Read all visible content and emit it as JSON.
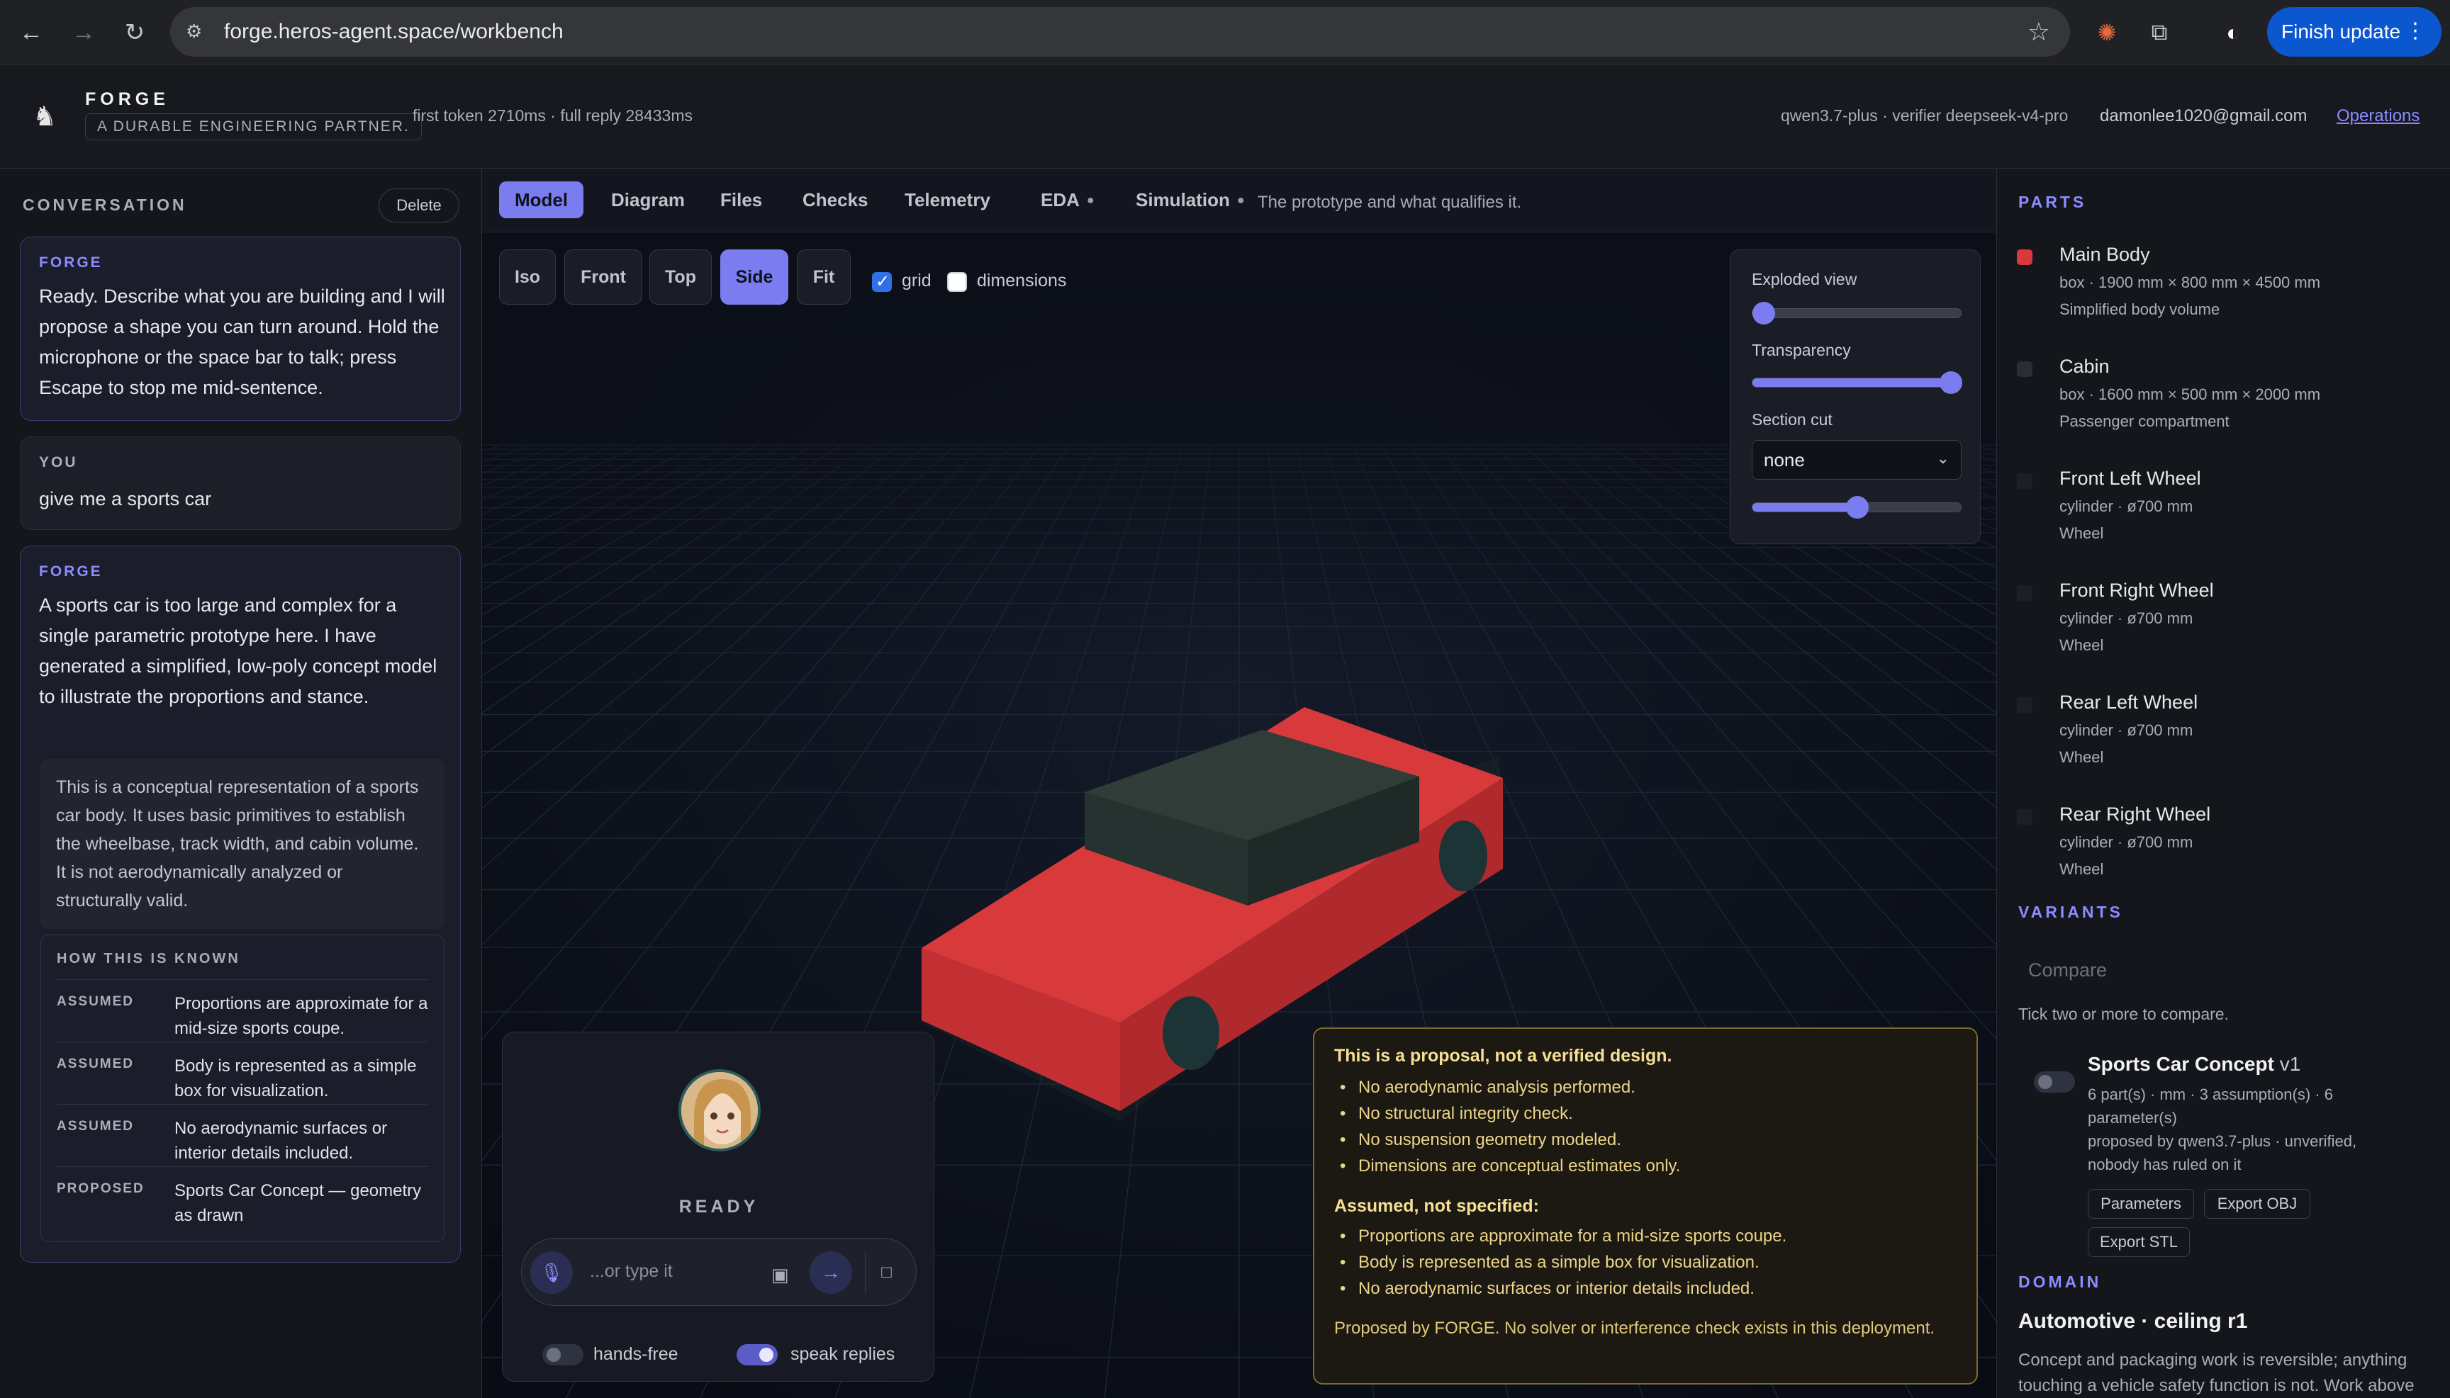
{
  "browser": {
    "url": "forge.heros-agent.space/workbench",
    "finish_update": "Finish update"
  },
  "header": {
    "brand": "FORGE",
    "tagline": "A DURABLE ENGINEERING PARTNER.",
    "timing": "first token 2710ms · full reply 28433ms",
    "model_info": "qwen3.7-plus · verifier deepseek-v4-pro",
    "user_email": "damonlee1020@gmail.com",
    "operations_link": "Operations"
  },
  "conversation": {
    "title": "CONVERSATION",
    "delete_label": "Delete",
    "messages": [
      {
        "sender": "FORGE",
        "text": "Ready. Describe what you are building and I will propose a shape you can turn around. Hold the microphone or the space bar to talk; press Escape to stop me mid-sentence."
      },
      {
        "sender": "YOU",
        "text": "give me a sports car"
      },
      {
        "sender": "FORGE",
        "text": "A sports car is too large and complex for a single parametric prototype here. I have generated a simplified, low-poly concept model to illustrate the proportions and stance.",
        "note": "This is a conceptual representation of a sports car body. It uses basic primitives to establish the wheelbase, track width, and cabin volume. It is not aerodynamically analyzed or structurally valid.",
        "known_title": "HOW THIS IS KNOWN",
        "known": [
          {
            "tag": "ASSUMED",
            "text": "Proportions are approximate for a mid-size sports coupe."
          },
          {
            "tag": "ASSUMED",
            "text": "Body is represented as a simple box for visualization."
          },
          {
            "tag": "ASSUMED",
            "text": "No aerodynamic surfaces or interior details included."
          },
          {
            "tag": "PROPOSED",
            "text": "Sports Car Concept — geometry as drawn"
          }
        ]
      }
    ]
  },
  "tabs": {
    "items": [
      "Model",
      "Diagram",
      "Files",
      "Checks",
      "Telemetry",
      "EDA",
      "Simulation"
    ],
    "dot": "●",
    "active": "Model",
    "description": "The prototype and what qualifies it."
  },
  "viewport": {
    "views": [
      "Iso",
      "Front",
      "Top",
      "Side",
      "Fit"
    ],
    "active_view": "Side",
    "grid_label": "grid",
    "grid_checked": true,
    "dimensions_label": "dimensions",
    "dimensions_checked": false,
    "controls": {
      "exploded_label": "Exploded view",
      "exploded_value": 0.0,
      "transparency_label": "Transparency",
      "transparency_value": 1.0,
      "section_label": "Section cut",
      "section_value": "none",
      "section_position": 0.5
    },
    "colors": {
      "body": "#d83a3c",
      "cabin": "#233230",
      "accent": "#7b7cf0"
    }
  },
  "voice": {
    "status": "READY",
    "input_placeholder": "...or type it",
    "hands_free_label": "hands-free",
    "hands_free_on": false,
    "speak_replies_label": "speak replies",
    "speak_replies_on": true
  },
  "proposal": {
    "title": "This is a proposal, not a verified design.",
    "items": [
      "No aerodynamic analysis performed.",
      "No structural integrity check.",
      "No suspension geometry modeled.",
      "Dimensions are conceptual estimates only."
    ],
    "assumed_title": "Assumed, not specified:",
    "assumed": [
      "Proportions are approximate for a mid-size sports coupe.",
      "Body is represented as a simple box for visualization.",
      "No aerodynamic surfaces or interior details included."
    ],
    "footer": "Proposed by FORGE. No solver or interference check exists in this deployment."
  },
  "parts": {
    "title": "PARTS",
    "items": [
      {
        "name": "Main Body",
        "dims": "box · 1900 mm × 800 mm × 4500 mm",
        "desc": "Simplified body volume",
        "color": "#d83a3c"
      },
      {
        "name": "Cabin",
        "dims": "box · 1600 mm × 500 mm × 2000 mm",
        "desc": "Passenger compartment",
        "color": "#2a2d36"
      },
      {
        "name": "Front Left Wheel",
        "dims": "cylinder · ø700 mm",
        "desc": "Wheel",
        "color": "#1c1f27"
      },
      {
        "name": "Front Right Wheel",
        "dims": "cylinder · ø700 mm",
        "desc": "Wheel",
        "color": "#1c1f27"
      },
      {
        "name": "Rear Left Wheel",
        "dims": "cylinder · ø700 mm",
        "desc": "Wheel",
        "color": "#1c1f27"
      },
      {
        "name": "Rear Right Wheel",
        "dims": "cylinder · ø700 mm",
        "desc": "Wheel",
        "color": "#1c1f27"
      }
    ]
  },
  "variants": {
    "title": "VARIANTS",
    "compare_placeholder": "Compare",
    "hint": "Tick two or more to compare.",
    "name": "Sports Car Concept",
    "version": "v1",
    "meta": "6 part(s) · mm · 3 assumption(s) · 6 parameter(s)",
    "proposed_by": "proposed by qwen3.7-plus · unverified, nobody has ruled on it",
    "buttons": [
      "Parameters",
      "Export OBJ",
      "Export STL"
    ]
  },
  "domain": {
    "title": "DOMAIN",
    "name": "Automotive · ceiling r1",
    "desc": "Concept and packaging work is reversible; anything touching a vehicle safety function is not. Work above"
  }
}
